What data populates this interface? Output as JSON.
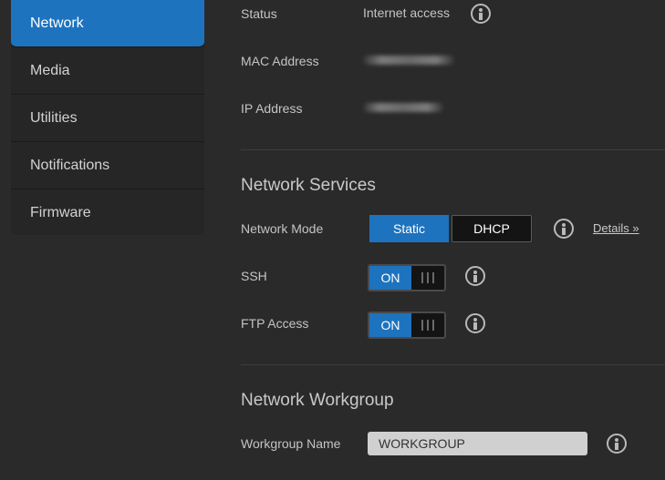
{
  "sidebar": {
    "items": [
      {
        "label": "Network",
        "active": true
      },
      {
        "label": "Media",
        "active": false
      },
      {
        "label": "Utilities",
        "active": false
      },
      {
        "label": "Notifications",
        "active": false
      },
      {
        "label": "Firmware",
        "active": false
      }
    ]
  },
  "status": {
    "label": "Status",
    "value": "Internet access"
  },
  "mac": {
    "label": "MAC Address"
  },
  "ip": {
    "label": "IP Address"
  },
  "network_services": {
    "title": "Network Services",
    "mode_label": "Network Mode",
    "mode_options": [
      "Static",
      "DHCP"
    ],
    "mode_selected": "Static",
    "details_link": "Details »",
    "ssh_label": "SSH",
    "ssh_state": "ON",
    "ftp_label": "FTP Access",
    "ftp_state": "ON"
  },
  "workgroup": {
    "title": "Network Workgroup",
    "name_label": "Workgroup Name",
    "name_value": "WORKGROUP"
  },
  "colors": {
    "accent": "#1e73be",
    "background": "#2a2a2a"
  }
}
